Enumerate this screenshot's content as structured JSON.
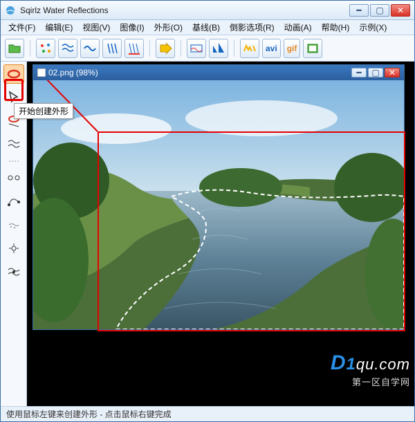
{
  "window": {
    "title": "Sqirlz Water Reflections",
    "menus": [
      "文件(F)",
      "编辑(E)",
      "视图(V)",
      "图像(I)",
      "外形(O)",
      "基线(B)",
      "倒影选项(R)",
      "动画(A)",
      "帮助(H)",
      "示例(X)"
    ]
  },
  "toolbar": {
    "items": [
      "open",
      "dots",
      "wave1",
      "wave2",
      "lines",
      "label-a",
      "label-b",
      "arrow",
      "box",
      "tri",
      "mw",
      "avi",
      "gif",
      "frame"
    ]
  },
  "vtoolbar": {
    "items": [
      "draw-outline",
      "pointer",
      "eraser",
      "wave",
      "anchors",
      "curve",
      "blur",
      "transform",
      "animate"
    ],
    "selected_index": 0,
    "tooltip": "开始创建外形"
  },
  "document": {
    "title": "02.png",
    "zoom": "(98%)"
  },
  "status": "使用鼠标左键来创建外形 - 点击鼠标右键完成",
  "watermark": {
    "d": "D",
    "one": "1",
    "rest": "qu.com",
    "sub": "第一区自学网"
  }
}
